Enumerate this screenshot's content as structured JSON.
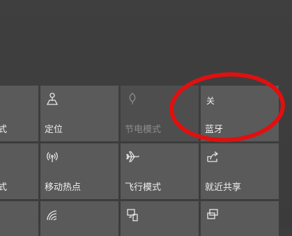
{
  "tiles": {
    "r1c1": {
      "label": "式"
    },
    "r1c2": {
      "label": "定位",
      "icon": "location-icon"
    },
    "r1c3": {
      "label": "节电模式",
      "icon": "battery-saver-icon"
    },
    "r1c4": {
      "label": "蓝牙",
      "state": "关"
    },
    "r2c1": {
      "label": "式"
    },
    "r2c2": {
      "label": "移动热点",
      "icon": "mobile-hotspot-icon"
    },
    "r2c3": {
      "label": "飞行模式",
      "icon": "airplane-icon"
    },
    "r2c4": {
      "label": "就近共享",
      "icon": "nearby-sharing-icon"
    }
  },
  "colors": {
    "background": "#3d3d3d",
    "tile": "#5a5a5a",
    "tile_disabled": "#4e4e4e",
    "annotation": "#e01010"
  }
}
